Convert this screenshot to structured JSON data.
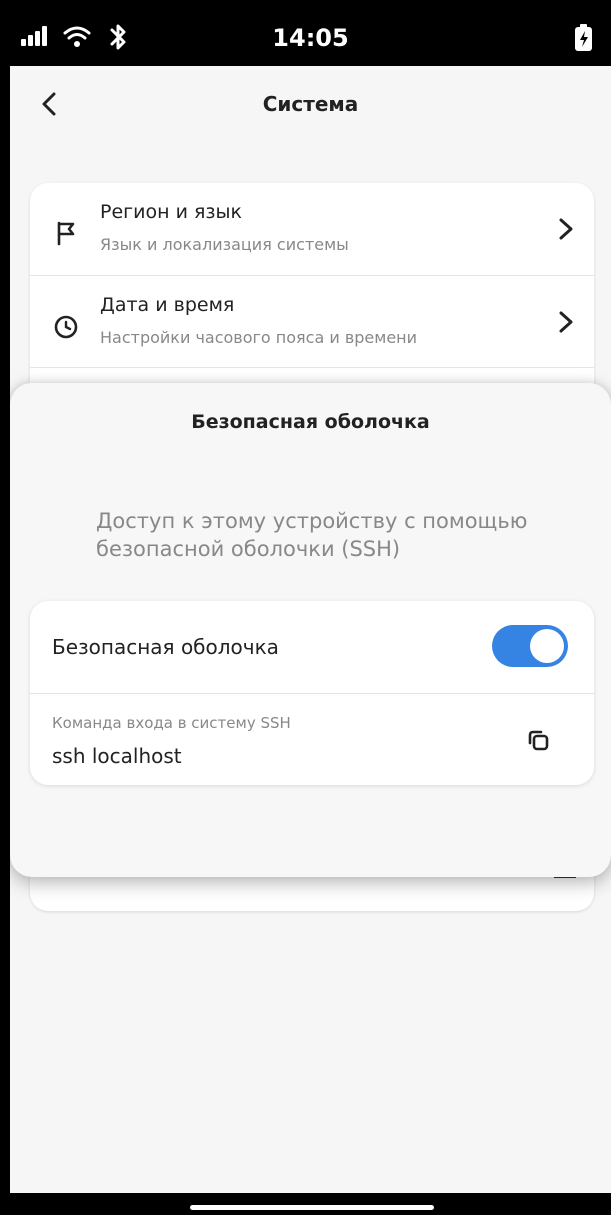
{
  "status_bar": {
    "time": "14:05",
    "icons": [
      "signal-icon",
      "wifi-icon",
      "bluetooth-icon",
      "battery-charging-icon"
    ]
  },
  "header": {
    "title": "Система",
    "back_icon": "chevron-left-icon"
  },
  "settings_list": {
    "items": [
      {
        "title": "Регион и язык",
        "subtitle": "Язык и локализация системы",
        "icon": "flag-icon"
      },
      {
        "title": "Дата и время",
        "subtitle": "Настройки часового пояса и времени",
        "icon": "clock-icon"
      }
    ]
  },
  "ssh_sheet": {
    "title": "Безопасная оболочка",
    "description": "Доступ к этому устройству с помощью безопасной оболочки (SSH)",
    "toggle": {
      "label": "Безопасная оболочка",
      "enabled": true
    },
    "command": {
      "label": "Команда входа в систему SSH",
      "value": "ssh localhost",
      "copy_icon": "copy-icon"
    }
  },
  "colors": {
    "accent": "#3584e4",
    "background": "#f6f6f6",
    "card": "#ffffff"
  }
}
